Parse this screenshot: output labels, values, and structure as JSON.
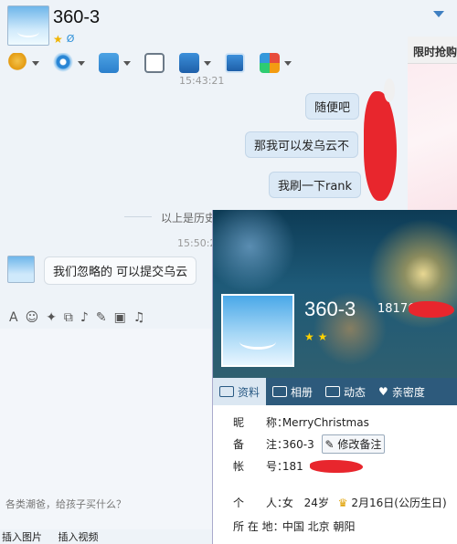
{
  "header": {
    "title": "360-3"
  },
  "toolbar": {
    "items": [
      "voice",
      "video",
      "file",
      "message-manager",
      "remote",
      "share-screen",
      "apps"
    ]
  },
  "ad": {
    "title": "限时抢购"
  },
  "chat": {
    "time_top": "15:43:21",
    "messages_right": [
      "随便吧",
      "那我可以发乌云不",
      "我刷一下rank"
    ],
    "history_label": "以上是历史",
    "time_bottom": "15:50:2",
    "message_left": "我们忽略的 可以提交乌云"
  },
  "input": {
    "placeholder": "各类潮爸，给孩子买什么？",
    "bottom_links": [
      "插入图片",
      "插入视频"
    ]
  },
  "profile": {
    "name": "360-3",
    "number": "18176",
    "tabs": [
      "资料",
      "相册",
      "动态",
      "亲密度"
    ],
    "nickname_label": "昵　　称：",
    "nickname": "MerryChristmas",
    "remark_label": "备　　注：",
    "remark": "360-3",
    "edit_remark": "修改备注",
    "account_label": "帐　　号：",
    "account": "181",
    "personal_label": "个　　人：",
    "gender": "女",
    "age": "24岁",
    "birthday": "2月16日(公历生日)",
    "location_label": "所 在 地：",
    "location": "中国 北京 朝阳"
  },
  "colors": {
    "accent": "#2d5a7c",
    "bubble": "#dbe9f6",
    "scribble": "#e8262d"
  }
}
